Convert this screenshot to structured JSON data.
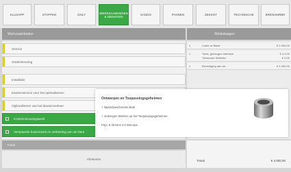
{
  "tabs": [
    {
      "label": "KLUSAPP"
    },
    {
      "label": "STAPPEN"
    },
    {
      "label": "ONLY"
    },
    {
      "label": "WERKZAAMHEDEN & DIENSTEN"
    },
    {
      "label": "SANDO"
    },
    {
      "label": "PANNEN"
    },
    {
      "label": "ZEKKOT"
    },
    {
      "label": "TECHNISCHE"
    },
    {
      "label": "BRENAMRBR"
    }
  ],
  "left_header": "Werkzaamheden",
  "list_items": [
    {
      "label": "Service"
    },
    {
      "label": "Ondersteuning"
    },
    {
      "label": "Installatie"
    },
    {
      "label": "Klantenservice voor het optimaliseren"
    },
    {
      "label": "Optimaliseren van het klantenverkeer"
    },
    {
      "label": "Koolvernieuwingswerk"
    },
    {
      "label": "Verspaarde buizenwerk en verbinding aan de klant"
    }
  ],
  "right_header": "Winkelwagen",
  "cart_rows": [
    {
      "qty": "1",
      "name": "Cutter of Blade",
      "price": "€ 4.450.00"
    },
    {
      "qty": "1",
      "name": "Toets, geheugen interface",
      "name2": "Toetsende Whitelist",
      "price": "€ 4.0.00",
      "price2": "€ 0.00"
    },
    {
      "qty": "1",
      "name": "Bevestiging aan de...",
      "price": "€ 4.450.00"
    }
  ],
  "popup": {
    "title": "Ontwerpen en Toepassingsgeheimen",
    "line1": "+ Naamsbeschreven Buik",
    "line2": "+ Verbergen Werken op het Toepassingsgeheimen",
    "price_line": "Prijs: € 40.50   € 4.0 Winnaar"
  },
  "footer": {
    "strip": "Totaal",
    "left_label": "Afrekenen",
    "total_label": "Totaal",
    "total_value": "€ 4.000,00"
  }
}
